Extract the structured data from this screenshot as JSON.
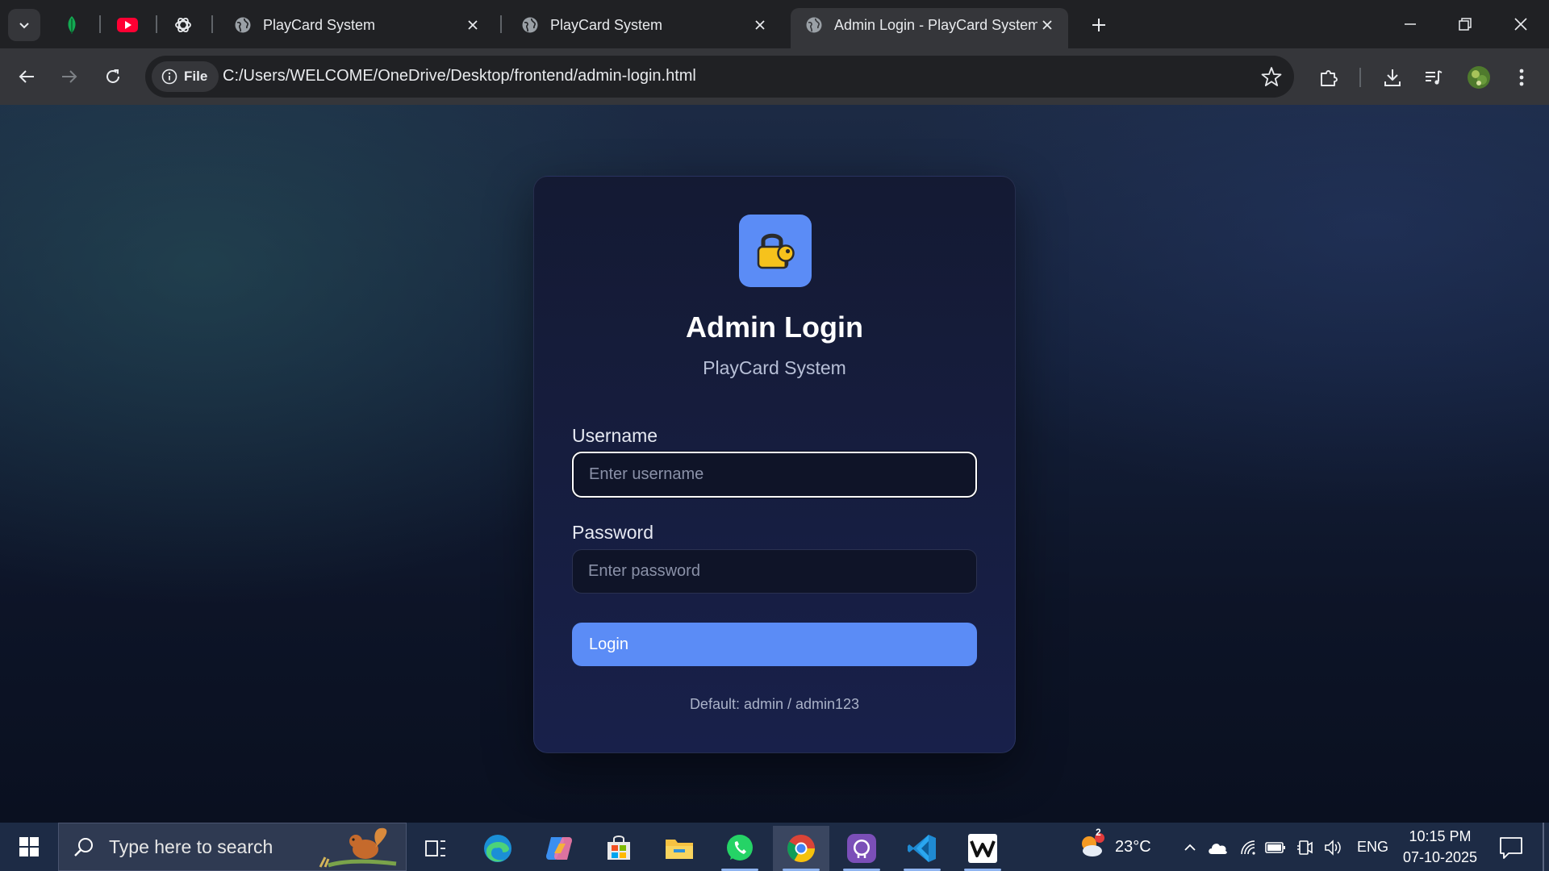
{
  "browser": {
    "tabs": [
      {
        "title": "PlayCard System",
        "active": false
      },
      {
        "title": "PlayCard System",
        "active": false
      },
      {
        "title": "Admin Login - PlayCard System",
        "active": true
      }
    ],
    "pinned_icons": [
      "leaf-icon",
      "youtube-icon",
      "openai-icon"
    ],
    "site_chip": "File",
    "url": "C:/Users/WELCOME/OneDrive/Desktop/frontend/admin-login.html"
  },
  "page": {
    "logo_icon": "lock-key-icon",
    "title": "Admin Login",
    "subtitle": "PlayCard System",
    "username_label": "Username",
    "username_placeholder": "Enter username",
    "username_value": "",
    "password_label": "Password",
    "password_placeholder": "Enter password",
    "password_value": "",
    "login_button": "Login",
    "hint": "Default: admin / admin123",
    "accent_color": "#5b8cf6"
  },
  "taskbar": {
    "search_placeholder": "Type here to search",
    "apps": [
      "task-view-icon",
      "edge-icon",
      "copilot-icon",
      "store-icon",
      "file-explorer-icon",
      "whatsapp-icon",
      "chrome-icon",
      "github-icon",
      "vscode-icon",
      "wondershare-icon"
    ],
    "weather_temp": "23°C",
    "weather_badge": "2",
    "language": "ENG",
    "time": "10:15 PM",
    "date": "07-10-2025"
  }
}
